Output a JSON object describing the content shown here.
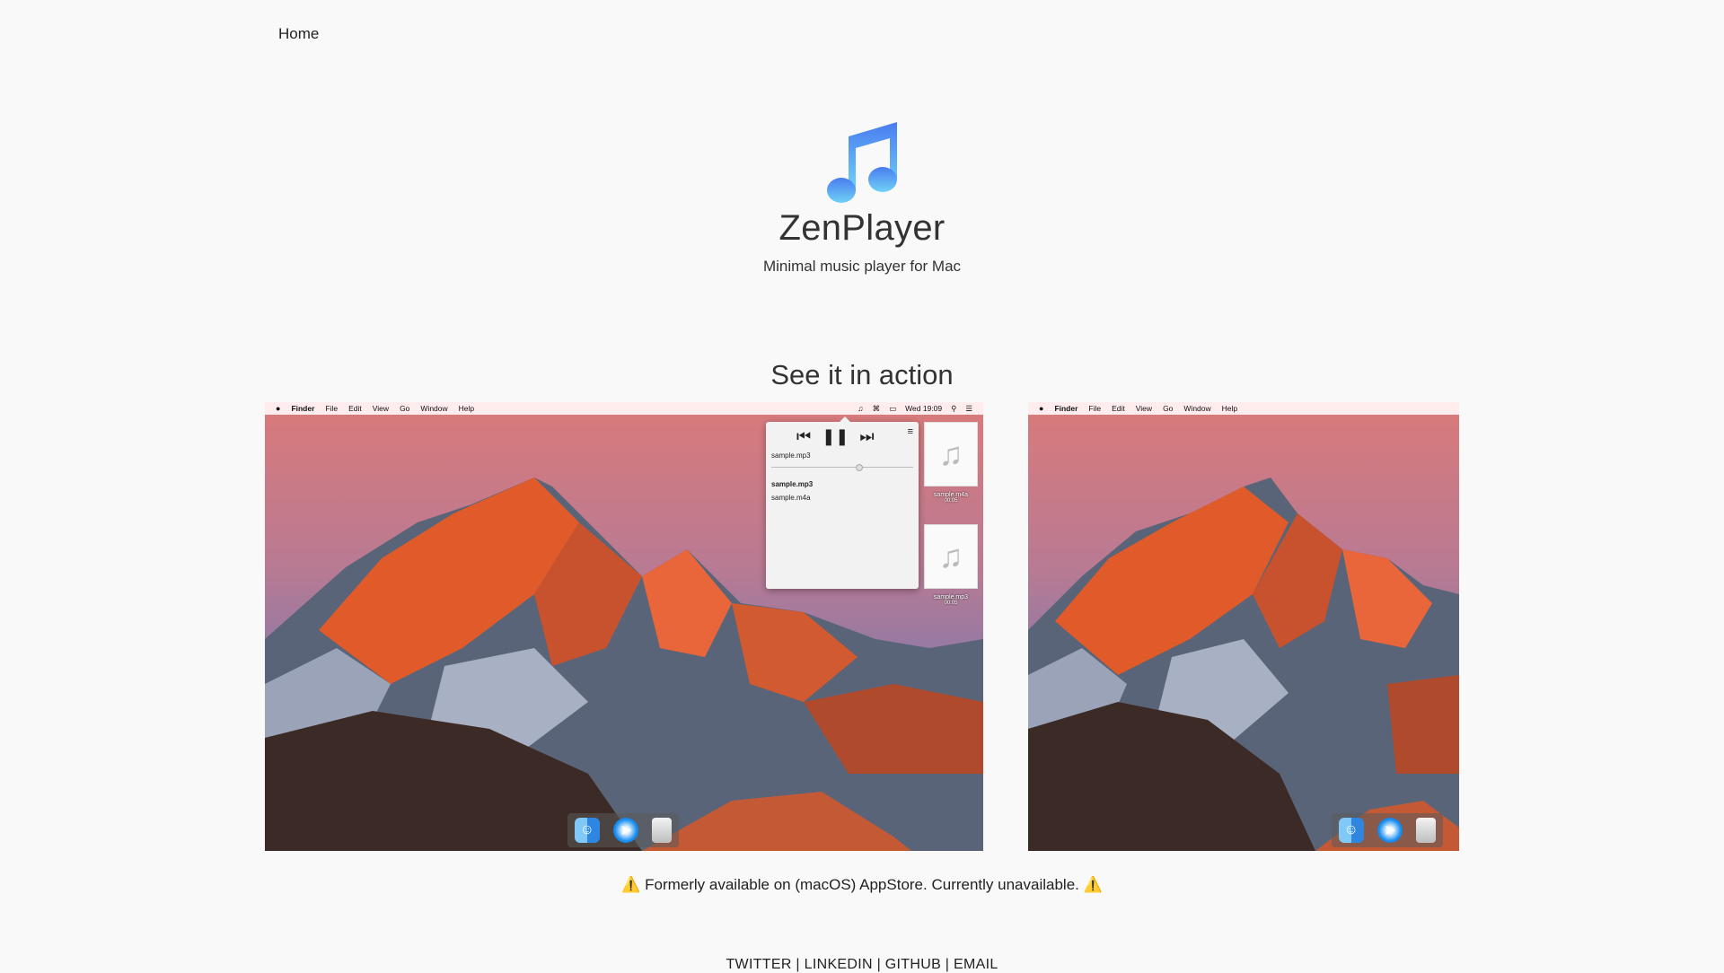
{
  "nav": {
    "home": "Home"
  },
  "hero": {
    "logo_icon": "music-note-icon",
    "title": "ZenPlayer",
    "subtitle": "Minimal music player for Mac"
  },
  "section": {
    "title": "See it in action"
  },
  "screenshot": {
    "menubar": {
      "apple_icon": "",
      "app": "Finder",
      "items": [
        "File",
        "Edit",
        "View",
        "Go",
        "Window",
        "Help"
      ],
      "clock": "Wed 19:09"
    },
    "player": {
      "now_playing": "sample.mp3",
      "progress": 0.62,
      "playlist": [
        "sample.mp3",
        "sample.m4a"
      ],
      "active_index": 0,
      "controls": [
        "previous-icon",
        "pause-icon",
        "next-icon"
      ],
      "menu_icon": "hamburger-icon"
    },
    "desktop_files": [
      {
        "name": "sample.m4a",
        "duration": "00:05"
      },
      {
        "name": "sample.mp3",
        "duration": "00:05"
      }
    ],
    "dock": [
      "finder-icon",
      "safari-icon",
      "trash-icon"
    ]
  },
  "notice": "⚠️ Formerly available on (macOS) AppStore. Currently unavailable. ⚠️",
  "footer": {
    "links": [
      "TWITTER",
      "LINKEDIN",
      "GITHUB",
      "EMAIL"
    ],
    "separator": " | "
  },
  "colors": {
    "background": "#f9f9f9",
    "accent": "#3b8fe6"
  }
}
